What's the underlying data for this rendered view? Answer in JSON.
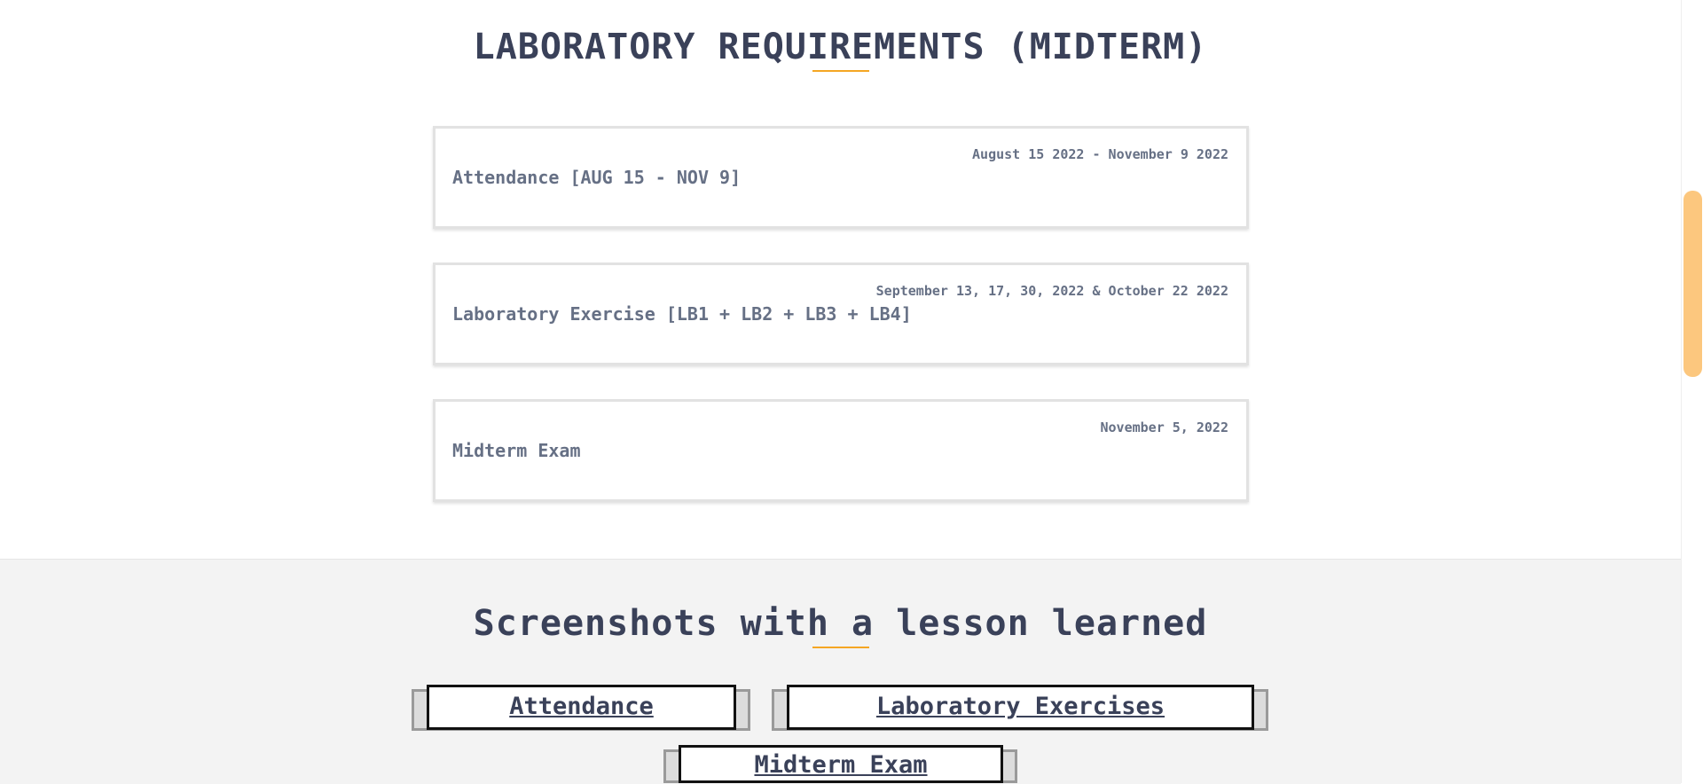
{
  "requirements_section": {
    "title": "LABORATORY REQUIREMENTS (MIDTERM)",
    "items": [
      {
        "title": "Attendance [AUG 15 - NOV 9]",
        "date": "August 15 2022 - November 9 2022"
      },
      {
        "title": "Laboratory Exercise [LB1 + LB2 + LB3 + LB4]",
        "date": "September 13, 17, 30, 2022 & October 22 2022"
      },
      {
        "title": "Midterm Exam",
        "date": "November 5, 2022"
      }
    ]
  },
  "screenshots_section": {
    "title": "Screenshots with a lesson learned",
    "buttons": [
      {
        "label": "Attendance"
      },
      {
        "label": "Laboratory Exercises"
      },
      {
        "label": "Midterm Exam"
      }
    ]
  },
  "colors": {
    "accent": "#f5a623",
    "heading": "#3a4159",
    "card_text": "#667085",
    "scroll_thumb": "#fcc77e"
  }
}
